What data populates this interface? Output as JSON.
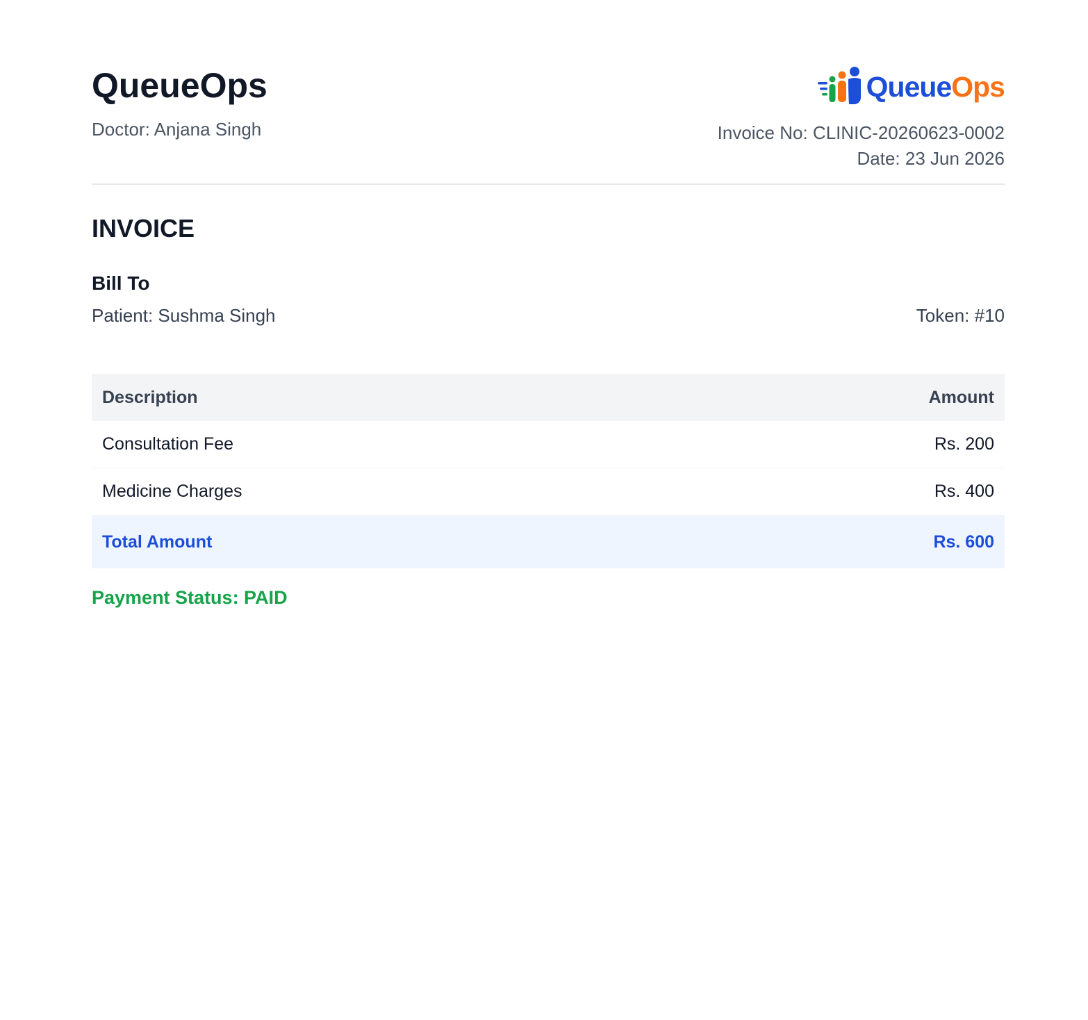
{
  "header": {
    "clinic_name": "QueueOps",
    "doctor_line": "Doctor: Anjana Singh",
    "invoice_no_line": "Invoice No: CLINIC-20260623-0002",
    "date_line": "Date: 23 Jun 2026"
  },
  "logo": {
    "text_part1": "Queue",
    "text_part2": "Ops",
    "icon": "people-queue-icon",
    "colors": {
      "blue": "#1d4ed8",
      "orange": "#f97316",
      "green": "#16a34a"
    }
  },
  "invoice": {
    "title": "INVOICE",
    "bill_to_label": "Bill To",
    "patient_line": "Patient: Sushma Singh",
    "token_line": "Token: #10"
  },
  "table": {
    "headers": {
      "description": "Description",
      "amount": "Amount"
    },
    "rows": [
      {
        "description": "Consultation Fee",
        "amount": "Rs. 200"
      },
      {
        "description": "Medicine Charges",
        "amount": "Rs. 400"
      }
    ],
    "total": {
      "label": "Total Amount",
      "amount": "Rs. 600"
    }
  },
  "payment": {
    "status_line": "Payment Status: PAID",
    "status_color": "#16a34a"
  }
}
